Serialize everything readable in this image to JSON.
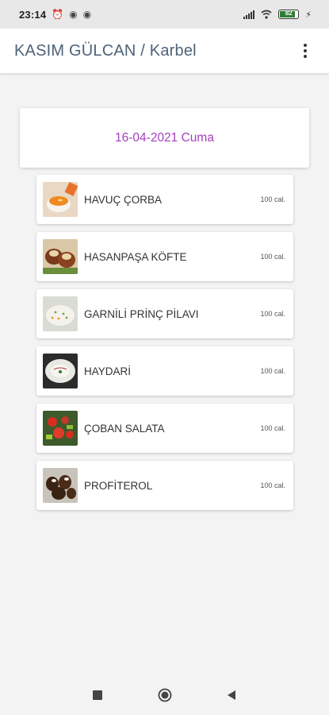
{
  "status_bar": {
    "time": "23:14",
    "battery_level": "82"
  },
  "app_bar": {
    "title": "KASIM GÜLCAN / Karbel",
    "menu_icon": "more-vert-icon"
  },
  "date_card": {
    "date": "16-04-2021 Cuma"
  },
  "menu_items": [
    {
      "name": "HAVUÇ ÇORBA",
      "calories": "100 cal."
    },
    {
      "name": "HASANPAŞA KÖFTE",
      "calories": "100 cal."
    },
    {
      "name": "GARNİLİ PRİNÇ PİLAVI",
      "calories": "100 cal."
    },
    {
      "name": "HAYDARİ",
      "calories": "100 cal."
    },
    {
      "name": "ÇOBAN SALATA",
      "calories": "100 cal."
    },
    {
      "name": "PROFİTEROL",
      "calories": "100 cal."
    }
  ],
  "colors": {
    "title": "#4e6278",
    "date": "#a43fbf",
    "background": "#f3f3f3"
  }
}
